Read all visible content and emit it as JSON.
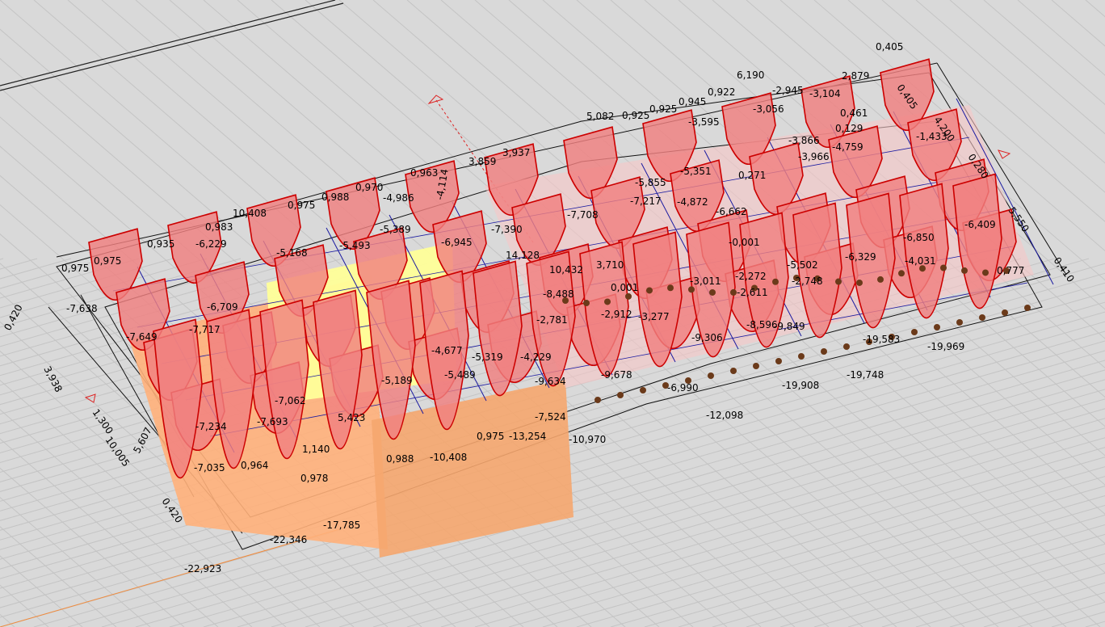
{
  "viewport": {
    "background": "#d9d9d9",
    "grid_color": "#c4c4c4",
    "diagram_fill": "#f08080",
    "diagram_stroke": "#cc0000",
    "plate_colors": [
      "#ffb07a",
      "#ffff99",
      "#f5a66e"
    ],
    "beam_color": "#1a1aa0"
  },
  "result_labels": [
    "0,405",
    "2,879",
    "0,405",
    "6,190",
    "-2,945",
    "-3,104",
    "0,922",
    "-3,056",
    "0,945",
    "0,925",
    "0,925",
    "5,082",
    "-3,595",
    "0,461",
    "0,129",
    "4,200",
    "-1,433",
    "-3,866",
    "-3,966",
    "-4,759",
    "0,280",
    "3,937",
    "3,859",
    "0,963",
    "-4,114",
    "-5,855",
    "-5,351",
    "0,271",
    "0,970",
    "0,988",
    "0,975",
    "10,408",
    "-4,986",
    "-7,217",
    "-4,872",
    "-6,662",
    "-6,409",
    "5,550",
    "0,983",
    "0,935",
    "-6,229",
    "-5,389",
    "-7,390",
    "-7,708",
    "-5,168",
    "-5,493",
    "-6,945",
    "-0,001",
    "-6,850",
    "-6,329",
    "-4,031",
    "0,975",
    "0,975",
    "14,128",
    "10,432",
    "3,710",
    "-5,502",
    "-2,748",
    "-2,272",
    "-2,611",
    "0,777",
    "0,410",
    "-6,709",
    "0,001",
    "-8,488",
    "-3,011",
    "0,420",
    "-7,638",
    "-7,649",
    "-7,717",
    "-2,781",
    "-2,912",
    "-3,277",
    "-4,677",
    "-5,319",
    "-4,229",
    "-9,306",
    "-8,596",
    "-9,849",
    "-19,969",
    "-19,583",
    "3,938",
    "-5,189",
    "-5,489",
    "-9,634",
    "-9,678",
    "-19,908",
    "-19,748",
    "1,300",
    "-7,062",
    "-7,693",
    "-7,234",
    "5,423",
    "-7,524",
    "-6,990",
    "-12,098",
    "10,005",
    "5,607",
    "1,140",
    "0,964",
    "0,978",
    "0,988",
    "-10,408",
    "0,975",
    "-13,254",
    "-10,970",
    "-7,035",
    "0,420",
    "-17,785",
    "-22,346",
    "-22,923"
  ]
}
